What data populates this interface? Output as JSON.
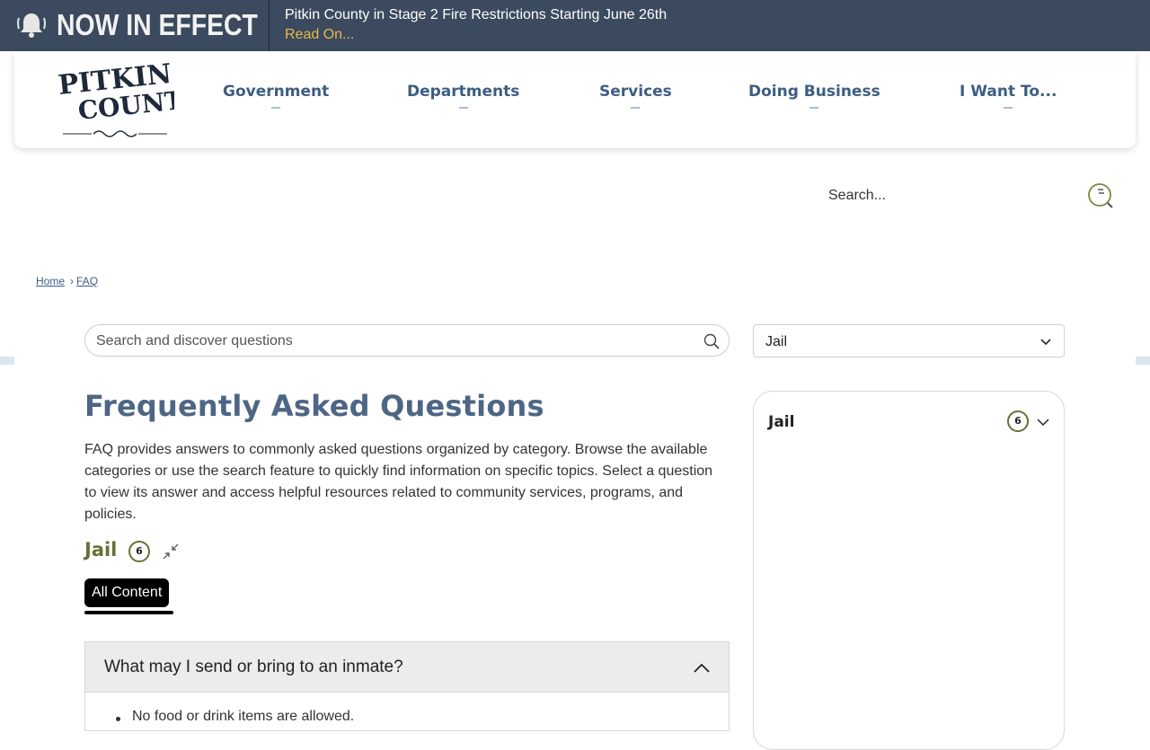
{
  "alert": {
    "heading": "NOW IN EFFECT",
    "title": "Pitkin County in Stage 2 Fire Restrictions Starting June 26th",
    "link": "Read On..."
  },
  "logo": {
    "line1": "PITKIN",
    "line2": "COUNTY"
  },
  "nav": {
    "items": [
      {
        "label": "Government"
      },
      {
        "label": "Departments"
      },
      {
        "label": "Services"
      },
      {
        "label": "Doing Business"
      },
      {
        "label": "I Want To..."
      }
    ]
  },
  "site_search": {
    "placeholder": "Search..."
  },
  "breadcrumb": {
    "home": "Home",
    "separator": "›",
    "current": "FAQ"
  },
  "faq_search": {
    "placeholder": "Search and discover questions"
  },
  "category_select": {
    "value": "Jail"
  },
  "page": {
    "title": "Frequently Asked Questions",
    "intro": "FAQ provides answers to commonly asked questions organized by category. Browse the available categories or use the search feature to quickly find information on specific topics. Select a question to view its answer and access helpful resources related to community services, programs, and policies."
  },
  "category": {
    "name": "Jail",
    "count": "6",
    "filter_label": "All Content"
  },
  "faq_items": [
    {
      "question": "What may I send or bring to an inmate?",
      "answer_first": "No food or drink items are allowed."
    }
  ],
  "side_panel": {
    "title": "Jail",
    "count": "6"
  },
  "colors": {
    "alert_bg": "#3b4a5e",
    "alert_link": "#e7b84a",
    "nav_text": "#3d5d82",
    "title": "#4e6685",
    "category_accent": "#6a6f35"
  }
}
